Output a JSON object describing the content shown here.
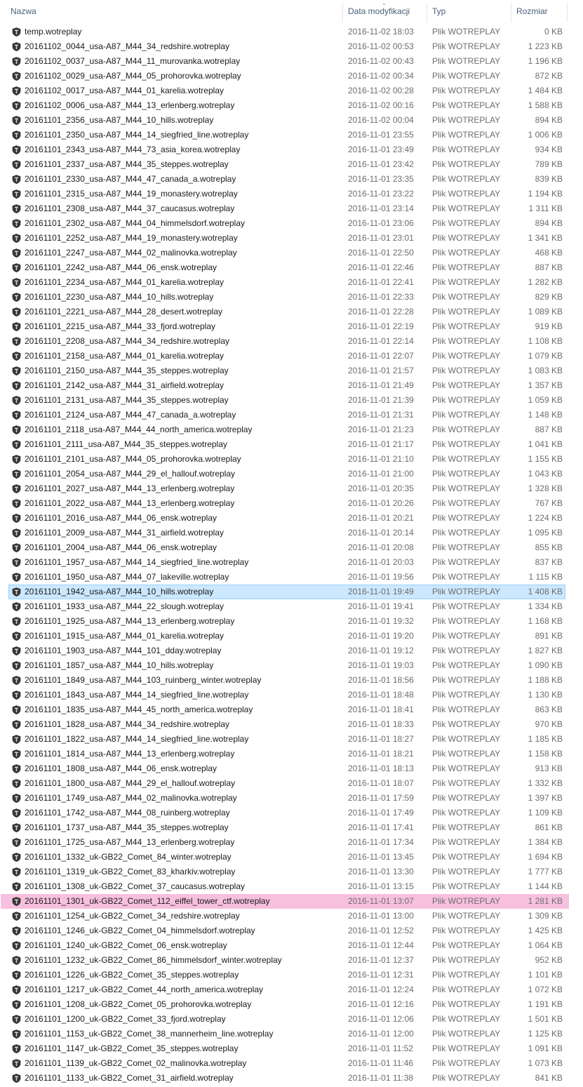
{
  "columns": {
    "name": "Nazwa",
    "date": "Data modyfikacji",
    "type": "Typ",
    "size": "Rozmiar"
  },
  "file_icon": "wot-replay-icon",
  "files": [
    {
      "name": "temp.wotreplay",
      "date": "2016-11-02 18:03",
      "type": "Plik WOTREPLAY",
      "size": "0 KB"
    },
    {
      "name": "20161102_0044_usa-A87_M44_34_redshire.wotreplay",
      "date": "2016-11-02 00:53",
      "type": "Plik WOTREPLAY",
      "size": "1 223 KB"
    },
    {
      "name": "20161102_0037_usa-A87_M44_11_murovanka.wotreplay",
      "date": "2016-11-02 00:43",
      "type": "Plik WOTREPLAY",
      "size": "1 196 KB"
    },
    {
      "name": "20161102_0029_usa-A87_M44_05_prohorovka.wotreplay",
      "date": "2016-11-02 00:34",
      "type": "Plik WOTREPLAY",
      "size": "872 KB"
    },
    {
      "name": "20161102_0017_usa-A87_M44_01_karelia.wotreplay",
      "date": "2016-11-02 00:28",
      "type": "Plik WOTREPLAY",
      "size": "1 484 KB"
    },
    {
      "name": "20161102_0006_usa-A87_M44_13_erlenberg.wotreplay",
      "date": "2016-11-02 00:16",
      "type": "Plik WOTREPLAY",
      "size": "1 588 KB"
    },
    {
      "name": "20161101_2356_usa-A87_M44_10_hills.wotreplay",
      "date": "2016-11-02 00:04",
      "type": "Plik WOTREPLAY",
      "size": "894 KB"
    },
    {
      "name": "20161101_2350_usa-A87_M44_14_siegfried_line.wotreplay",
      "date": "2016-11-01 23:55",
      "type": "Plik WOTREPLAY",
      "size": "1 006 KB"
    },
    {
      "name": "20161101_2343_usa-A87_M44_73_asia_korea.wotreplay",
      "date": "2016-11-01 23:49",
      "type": "Plik WOTREPLAY",
      "size": "934 KB"
    },
    {
      "name": "20161101_2337_usa-A87_M44_35_steppes.wotreplay",
      "date": "2016-11-01 23:42",
      "type": "Plik WOTREPLAY",
      "size": "789 KB"
    },
    {
      "name": "20161101_2330_usa-A87_M44_47_canada_a.wotreplay",
      "date": "2016-11-01 23:35",
      "type": "Plik WOTREPLAY",
      "size": "839 KB"
    },
    {
      "name": "20161101_2315_usa-A87_M44_19_monastery.wotreplay",
      "date": "2016-11-01 23:22",
      "type": "Plik WOTREPLAY",
      "size": "1 194 KB"
    },
    {
      "name": "20161101_2308_usa-A87_M44_37_caucasus.wotreplay",
      "date": "2016-11-01 23:14",
      "type": "Plik WOTREPLAY",
      "size": "1 311 KB"
    },
    {
      "name": "20161101_2302_usa-A87_M44_04_himmelsdorf.wotreplay",
      "date": "2016-11-01 23:06",
      "type": "Plik WOTREPLAY",
      "size": "894 KB"
    },
    {
      "name": "20161101_2252_usa-A87_M44_19_monastery.wotreplay",
      "date": "2016-11-01 23:01",
      "type": "Plik WOTREPLAY",
      "size": "1 341 KB"
    },
    {
      "name": "20161101_2247_usa-A87_M44_02_malinovka.wotreplay",
      "date": "2016-11-01 22:50",
      "type": "Plik WOTREPLAY",
      "size": "468 KB"
    },
    {
      "name": "20161101_2242_usa-A87_M44_06_ensk.wotreplay",
      "date": "2016-11-01 22:46",
      "type": "Plik WOTREPLAY",
      "size": "887 KB"
    },
    {
      "name": "20161101_2234_usa-A87_M44_01_karelia.wotreplay",
      "date": "2016-11-01 22:41",
      "type": "Plik WOTREPLAY",
      "size": "1 282 KB"
    },
    {
      "name": "20161101_2230_usa-A87_M44_10_hills.wotreplay",
      "date": "2016-11-01 22:33",
      "type": "Plik WOTREPLAY",
      "size": "829 KB"
    },
    {
      "name": "20161101_2221_usa-A87_M44_28_desert.wotreplay",
      "date": "2016-11-01 22:28",
      "type": "Plik WOTREPLAY",
      "size": "1 089 KB"
    },
    {
      "name": "20161101_2215_usa-A87_M44_33_fjord.wotreplay",
      "date": "2016-11-01 22:19",
      "type": "Plik WOTREPLAY",
      "size": "919 KB"
    },
    {
      "name": "20161101_2208_usa-A87_M44_34_redshire.wotreplay",
      "date": "2016-11-01 22:14",
      "type": "Plik WOTREPLAY",
      "size": "1 108 KB"
    },
    {
      "name": "20161101_2158_usa-A87_M44_01_karelia.wotreplay",
      "date": "2016-11-01 22:07",
      "type": "Plik WOTREPLAY",
      "size": "1 079 KB"
    },
    {
      "name": "20161101_2150_usa-A87_M44_35_steppes.wotreplay",
      "date": "2016-11-01 21:57",
      "type": "Plik WOTREPLAY",
      "size": "1 083 KB"
    },
    {
      "name": "20161101_2142_usa-A87_M44_31_airfield.wotreplay",
      "date": "2016-11-01 21:49",
      "type": "Plik WOTREPLAY",
      "size": "1 357 KB"
    },
    {
      "name": "20161101_2131_usa-A87_M44_35_steppes.wotreplay",
      "date": "2016-11-01 21:39",
      "type": "Plik WOTREPLAY",
      "size": "1 059 KB"
    },
    {
      "name": "20161101_2124_usa-A87_M44_47_canada_a.wotreplay",
      "date": "2016-11-01 21:31",
      "type": "Plik WOTREPLAY",
      "size": "1 148 KB"
    },
    {
      "name": "20161101_2118_usa-A87_M44_44_north_america.wotreplay",
      "date": "2016-11-01 21:23",
      "type": "Plik WOTREPLAY",
      "size": "887 KB"
    },
    {
      "name": "20161101_2111_usa-A87_M44_35_steppes.wotreplay",
      "date": "2016-11-01 21:17",
      "type": "Plik WOTREPLAY",
      "size": "1 041 KB"
    },
    {
      "name": "20161101_2101_usa-A87_M44_05_prohorovka.wotreplay",
      "date": "2016-11-01 21:10",
      "type": "Plik WOTREPLAY",
      "size": "1 155 KB"
    },
    {
      "name": "20161101_2054_usa-A87_M44_29_el_hallouf.wotreplay",
      "date": "2016-11-01 21:00",
      "type": "Plik WOTREPLAY",
      "size": "1 043 KB"
    },
    {
      "name": "20161101_2027_usa-A87_M44_13_erlenberg.wotreplay",
      "date": "2016-11-01 20:35",
      "type": "Plik WOTREPLAY",
      "size": "1 328 KB"
    },
    {
      "name": "20161101_2022_usa-A87_M44_13_erlenberg.wotreplay",
      "date": "2016-11-01 20:26",
      "type": "Plik WOTREPLAY",
      "size": "767 KB"
    },
    {
      "name": "20161101_2016_usa-A87_M44_06_ensk.wotreplay",
      "date": "2016-11-01 20:21",
      "type": "Plik WOTREPLAY",
      "size": "1 224 KB"
    },
    {
      "name": "20161101_2009_usa-A87_M44_31_airfield.wotreplay",
      "date": "2016-11-01 20:14",
      "type": "Plik WOTREPLAY",
      "size": "1 095 KB"
    },
    {
      "name": "20161101_2004_usa-A87_M44_06_ensk.wotreplay",
      "date": "2016-11-01 20:08",
      "type": "Plik WOTREPLAY",
      "size": "855 KB"
    },
    {
      "name": "20161101_1957_usa-A87_M44_14_siegfried_line.wotreplay",
      "date": "2016-11-01 20:03",
      "type": "Plik WOTREPLAY",
      "size": "837 KB"
    },
    {
      "name": "20161101_1950_usa-A87_M44_07_lakeville.wotreplay",
      "date": "2016-11-01 19:56",
      "type": "Plik WOTREPLAY",
      "size": "1 115 KB"
    },
    {
      "name": "20161101_1942_usa-A87_M44_10_hills.wotreplay",
      "date": "2016-11-01 19:49",
      "type": "Plik WOTREPLAY",
      "size": "1 408 KB",
      "state": "selected"
    },
    {
      "name": "20161101_1933_usa-A87_M44_22_slough.wotreplay",
      "date": "2016-11-01 19:41",
      "type": "Plik WOTREPLAY",
      "size": "1 334 KB"
    },
    {
      "name": "20161101_1925_usa-A87_M44_13_erlenberg.wotreplay",
      "date": "2016-11-01 19:32",
      "type": "Plik WOTREPLAY",
      "size": "1 168 KB"
    },
    {
      "name": "20161101_1915_usa-A87_M44_01_karelia.wotreplay",
      "date": "2016-11-01 19:20",
      "type": "Plik WOTREPLAY",
      "size": "891 KB"
    },
    {
      "name": "20161101_1903_usa-A87_M44_101_dday.wotreplay",
      "date": "2016-11-01 19:12",
      "type": "Plik WOTREPLAY",
      "size": "1 827 KB"
    },
    {
      "name": "20161101_1857_usa-A87_M44_10_hills.wotreplay",
      "date": "2016-11-01 19:03",
      "type": "Plik WOTREPLAY",
      "size": "1 090 KB"
    },
    {
      "name": "20161101_1849_usa-A87_M44_103_ruinberg_winter.wotreplay",
      "date": "2016-11-01 18:56",
      "type": "Plik WOTREPLAY",
      "size": "1 188 KB"
    },
    {
      "name": "20161101_1843_usa-A87_M44_14_siegfried_line.wotreplay",
      "date": "2016-11-01 18:48",
      "type": "Plik WOTREPLAY",
      "size": "1 130 KB"
    },
    {
      "name": "20161101_1835_usa-A87_M44_45_north_america.wotreplay",
      "date": "2016-11-01 18:41",
      "type": "Plik WOTREPLAY",
      "size": "863 KB"
    },
    {
      "name": "20161101_1828_usa-A87_M44_34_redshire.wotreplay",
      "date": "2016-11-01 18:33",
      "type": "Plik WOTREPLAY",
      "size": "970 KB"
    },
    {
      "name": "20161101_1822_usa-A87_M44_14_siegfried_line.wotreplay",
      "date": "2016-11-01 18:27",
      "type": "Plik WOTREPLAY",
      "size": "1 185 KB"
    },
    {
      "name": "20161101_1814_usa-A87_M44_13_erlenberg.wotreplay",
      "date": "2016-11-01 18:21",
      "type": "Plik WOTREPLAY",
      "size": "1 158 KB"
    },
    {
      "name": "20161101_1808_usa-A87_M44_06_ensk.wotreplay",
      "date": "2016-11-01 18:13",
      "type": "Plik WOTREPLAY",
      "size": "913 KB"
    },
    {
      "name": "20161101_1800_usa-A87_M44_29_el_hallouf.wotreplay",
      "date": "2016-11-01 18:07",
      "type": "Plik WOTREPLAY",
      "size": "1 332 KB"
    },
    {
      "name": "20161101_1749_usa-A87_M44_02_malinovka.wotreplay",
      "date": "2016-11-01 17:59",
      "type": "Plik WOTREPLAY",
      "size": "1 397 KB"
    },
    {
      "name": "20161101_1742_usa-A87_M44_08_ruinberg.wotreplay",
      "date": "2016-11-01 17:49",
      "type": "Plik WOTREPLAY",
      "size": "1 109 KB"
    },
    {
      "name": "20161101_1737_usa-A87_M44_35_steppes.wotreplay",
      "date": "2016-11-01 17:41",
      "type": "Plik WOTREPLAY",
      "size": "861 KB"
    },
    {
      "name": "20161101_1725_usa-A87_M44_13_erlenberg.wotreplay",
      "date": "2016-11-01 17:34",
      "type": "Plik WOTREPLAY",
      "size": "1 384 KB"
    },
    {
      "name": "20161101_1332_uk-GB22_Comet_84_winter.wotreplay",
      "date": "2016-11-01 13:45",
      "type": "Plik WOTREPLAY",
      "size": "1 694 KB"
    },
    {
      "name": "20161101_1319_uk-GB22_Comet_83_kharkiv.wotreplay",
      "date": "2016-11-01 13:30",
      "type": "Plik WOTREPLAY",
      "size": "1 777 KB"
    },
    {
      "name": "20161101_1308_uk-GB22_Comet_37_caucasus.wotreplay",
      "date": "2016-11-01 13:15",
      "type": "Plik WOTREPLAY",
      "size": "1 144 KB"
    },
    {
      "name": "20161101_1301_uk-GB22_Comet_112_eiffel_tower_ctf.wotreplay",
      "date": "2016-11-01 13:07",
      "type": "Plik WOTREPLAY",
      "size": "1 281 KB",
      "state": "marked"
    },
    {
      "name": "20161101_1254_uk-GB22_Comet_34_redshire.wotreplay",
      "date": "2016-11-01 13:00",
      "type": "Plik WOTREPLAY",
      "size": "1 309 KB"
    },
    {
      "name": "20161101_1246_uk-GB22_Comet_04_himmelsdorf.wotreplay",
      "date": "2016-11-01 12:52",
      "type": "Plik WOTREPLAY",
      "size": "1 425 KB"
    },
    {
      "name": "20161101_1240_uk-GB22_Comet_06_ensk.wotreplay",
      "date": "2016-11-01 12:44",
      "type": "Plik WOTREPLAY",
      "size": "1 064 KB"
    },
    {
      "name": "20161101_1232_uk-GB22_Comet_86_himmelsdorf_winter.wotreplay",
      "date": "2016-11-01 12:37",
      "type": "Plik WOTREPLAY",
      "size": "952 KB"
    },
    {
      "name": "20161101_1226_uk-GB22_Comet_35_steppes.wotreplay",
      "date": "2016-11-01 12:31",
      "type": "Plik WOTREPLAY",
      "size": "1 101 KB"
    },
    {
      "name": "20161101_1217_uk-GB22_Comet_44_north_america.wotreplay",
      "date": "2016-11-01 12:24",
      "type": "Plik WOTREPLAY",
      "size": "1 072 KB"
    },
    {
      "name": "20161101_1208_uk-GB22_Comet_05_prohorovka.wotreplay",
      "date": "2016-11-01 12:16",
      "type": "Plik WOTREPLAY",
      "size": "1 191 KB"
    },
    {
      "name": "20161101_1200_uk-GB22_Comet_33_fjord.wotreplay",
      "date": "2016-11-01 12:06",
      "type": "Plik WOTREPLAY",
      "size": "1 501 KB"
    },
    {
      "name": "20161101_1153_uk-GB22_Comet_38_mannerheim_line.wotreplay",
      "date": "2016-11-01 12:00",
      "type": "Plik WOTREPLAY",
      "size": "1 125 KB"
    },
    {
      "name": "20161101_1147_uk-GB22_Comet_35_steppes.wotreplay",
      "date": "2016-11-01 11:52",
      "type": "Plik WOTREPLAY",
      "size": "1 091 KB"
    },
    {
      "name": "20161101_1139_uk-GB22_Comet_02_malinovka.wotreplay",
      "date": "2016-11-01 11:46",
      "type": "Plik WOTREPLAY",
      "size": "1 073 KB"
    },
    {
      "name": "20161101_1133_uk-GB22_Comet_31_airfield.wotreplay",
      "date": "2016-11-01 11:38",
      "type": "Plik WOTREPLAY",
      "size": "841 KB"
    }
  ]
}
